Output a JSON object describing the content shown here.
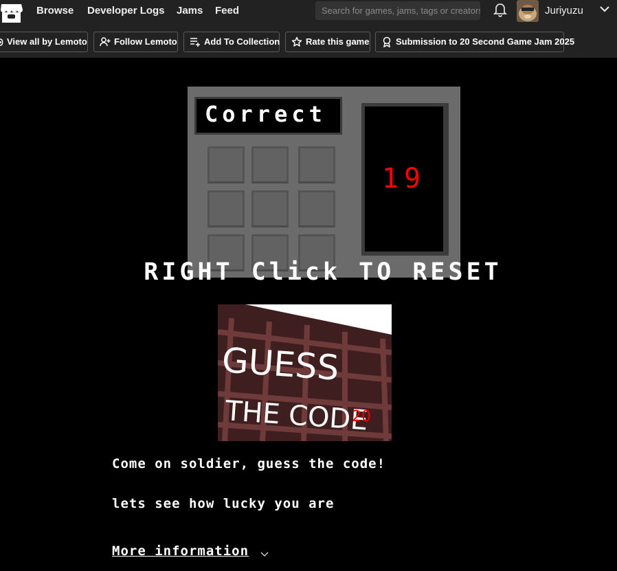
{
  "nav": {
    "links": [
      "Browse",
      "Developer Logs",
      "Jams",
      "Feed"
    ],
    "search_placeholder": "Search for games, jams, tags or creators",
    "username": "Juriyuzu",
    "icons": [
      "itchio-logo-icon",
      "bell-icon",
      "chevron-down-icon"
    ]
  },
  "actions": [
    {
      "label": "View all by Lemoto",
      "icon": "gamepad-icon"
    },
    {
      "label": "Follow Lemoto",
      "icon": "user-plus-icon"
    },
    {
      "label": "Add To Collection",
      "icon": "add-list-icon"
    },
    {
      "label": "Rate this game",
      "icon": "star-icon"
    },
    {
      "label": "Submission to 20 Second Game Jam 2025",
      "icon": "award-icon"
    }
  ],
  "game": {
    "display_text": "Correct",
    "counter": "19",
    "reset_label": "RIGHT Click TO RESET",
    "colors": {
      "panel": "#6b6b6b",
      "counter": "#ff0000"
    }
  },
  "cover": {
    "title_line1": "GUESS",
    "title_line2": "THE CODE",
    "badge": "20"
  },
  "description": {
    "line1": "Come on soldier, guess the code!",
    "line2": "lets see how lucky you are",
    "more_info": "More information"
  }
}
